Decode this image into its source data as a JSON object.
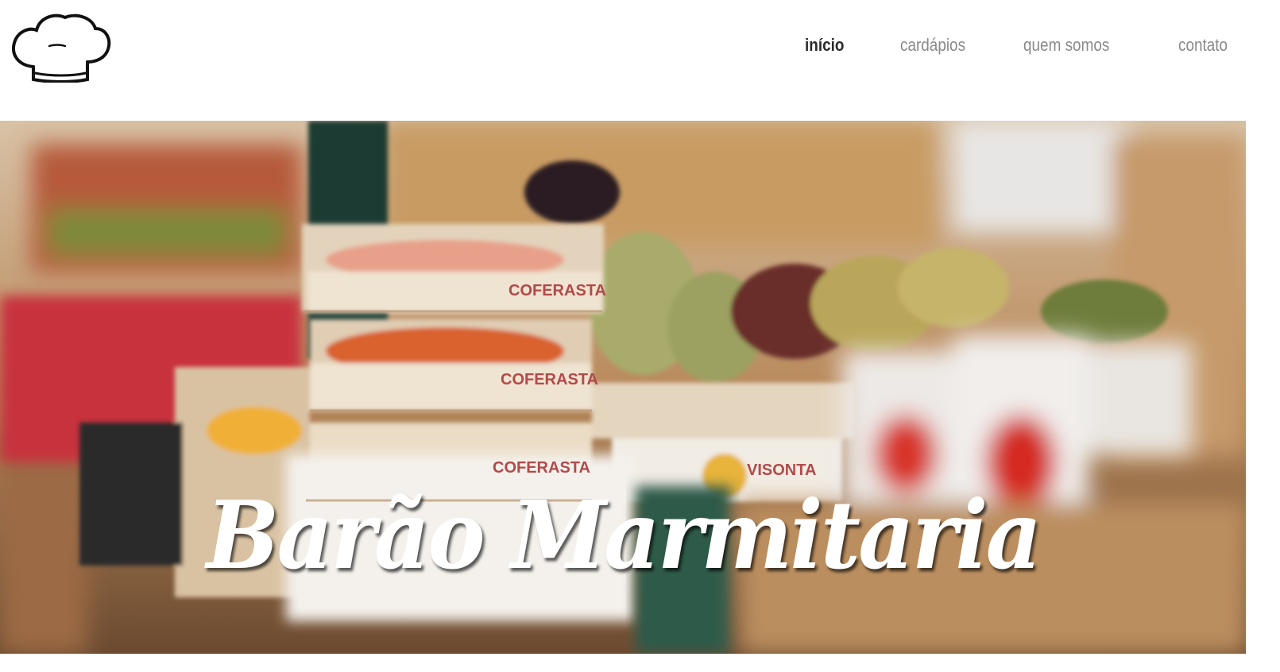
{
  "header": {
    "logo_icon": "chef-hat-icon"
  },
  "nav": {
    "items": [
      {
        "label": "início",
        "active": true
      },
      {
        "label": "cardápios",
        "active": false
      },
      {
        "label": "quem somos",
        "active": false
      },
      {
        "label": "contato",
        "active": false
      }
    ]
  },
  "hero": {
    "title": "Barão Marmitaria",
    "crate_label": "COFERASTA",
    "crate_label_2": "VISONTA"
  },
  "colors": {
    "nav_active": "#2a2a2a",
    "nav_inactive": "#8a8a8a",
    "title": "#ffffff"
  }
}
